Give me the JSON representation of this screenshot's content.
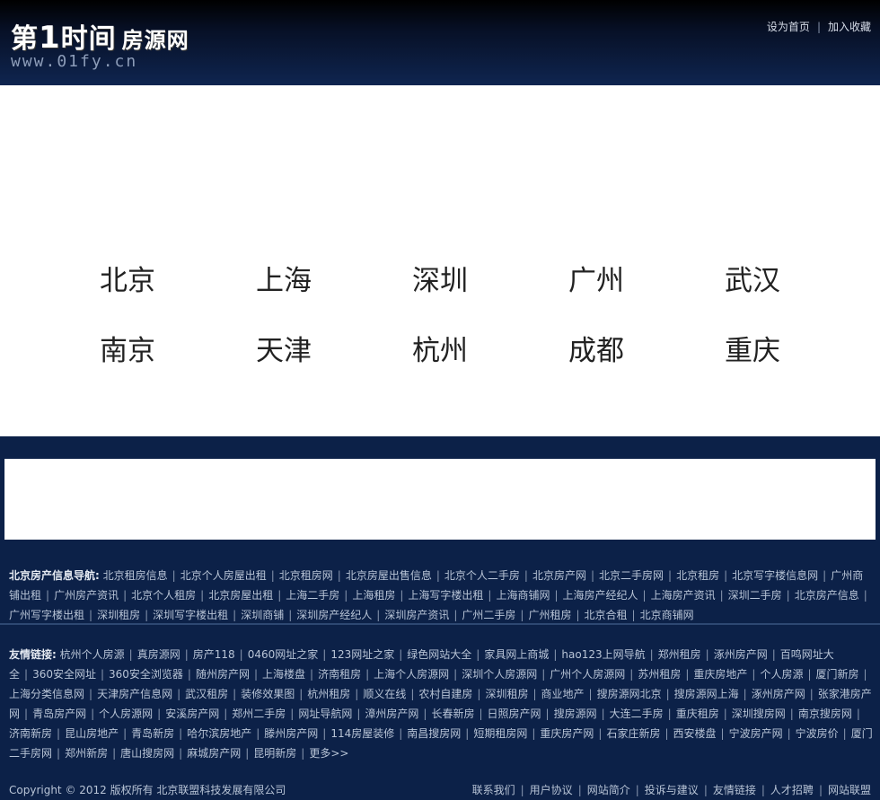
{
  "header": {
    "logo_main_prefix": "第",
    "logo_main_number": "1",
    "logo_main_rest": "时间",
    "logo_main_suffix": "房源网",
    "logo_url": "www.01fy.cn",
    "links": [
      "设为首页",
      "加入收藏"
    ]
  },
  "cities": {
    "row1": [
      "北京",
      "上海",
      "深圳",
      "广州",
      "武汉"
    ],
    "row2": [
      "南京",
      "天津",
      "杭州",
      "成都",
      "重庆"
    ]
  },
  "nav": {
    "title": "北京房产信息导航:",
    "items": [
      "北京租房信息",
      "北京个人房屋出租",
      "北京租房网",
      "北京房屋出售信息",
      "北京个人二手房",
      "北京房产网",
      "北京二手房网",
      "北京租房",
      "北京写字楼信息网",
      "广州商铺出租",
      "广州房产资讯",
      "北京个人租房",
      "北京房屋出租",
      "上海二手房",
      "上海租房",
      "上海写字楼出租",
      "上海商铺网",
      "上海房产经纪人",
      "上海房产资讯",
      "深圳二手房",
      "北京房产信息",
      "广州写字楼出租",
      "深圳租房",
      "深圳写字楼出租",
      "深圳商铺",
      "深圳房产经纪人",
      "深圳房产资讯",
      "广州二手房",
      "广州租房",
      "北京合租",
      "北京商铺网"
    ]
  },
  "friends": {
    "title": "友情链接:",
    "items": [
      "杭州个人房源",
      "真房源网",
      "房产118",
      "0460网址之家",
      "123网址之家",
      "绿色网站大全",
      "家具网上商城",
      "hao123上网导航",
      "郑州租房",
      "涿州房产网",
      "百鸣网址大全",
      "360安全网址",
      "360安全浏览器",
      "随州房产网",
      "上海楼盘",
      "济南租房",
      "上海个人房源网",
      "深圳个人房源网",
      "广州个人房源网",
      "苏州租房",
      "重庆房地产",
      "个人房源",
      "厦门新房",
      "上海分类信息网",
      "天津房产信息网",
      "武汉租房",
      "装修效果图",
      "杭州租房",
      "顺义在线",
      "农村自建房",
      "深圳租房",
      "商业地产",
      "搜房源网北京",
      "搜房源网上海",
      "涿州房产网",
      "张家港房产网",
      "青岛房产网",
      "个人房源网",
      "安溪房产网",
      "郑州二手房",
      "网址导航网",
      "漳州房产网",
      "长春新房",
      "日照房产网",
      "搜房源网",
      "大连二手房",
      "重庆租房",
      "深圳搜房网",
      "南京搜房网",
      "济南新房",
      "昆山房地产",
      "青岛新房",
      "哈尔滨房地产",
      "滕州房产网",
      "114房屋装修",
      "南昌搜房网",
      "短期租房网",
      "重庆房产网",
      "石家庄新房",
      "西安楼盘",
      "宁波房产网",
      "宁波房价",
      "厦门二手房网",
      "郑州新房",
      "唐山搜房网",
      "麻城房产网",
      "昆明新房",
      "更多>>"
    ]
  },
  "footer": {
    "copyright": "Copyright © 2012 版权所有 北京联盟科技发展有限公司",
    "links": [
      "联系我们",
      "用户协议",
      "网站简介",
      "投诉与建议",
      "友情链接",
      "人才招聘",
      "网站联盟"
    ]
  }
}
